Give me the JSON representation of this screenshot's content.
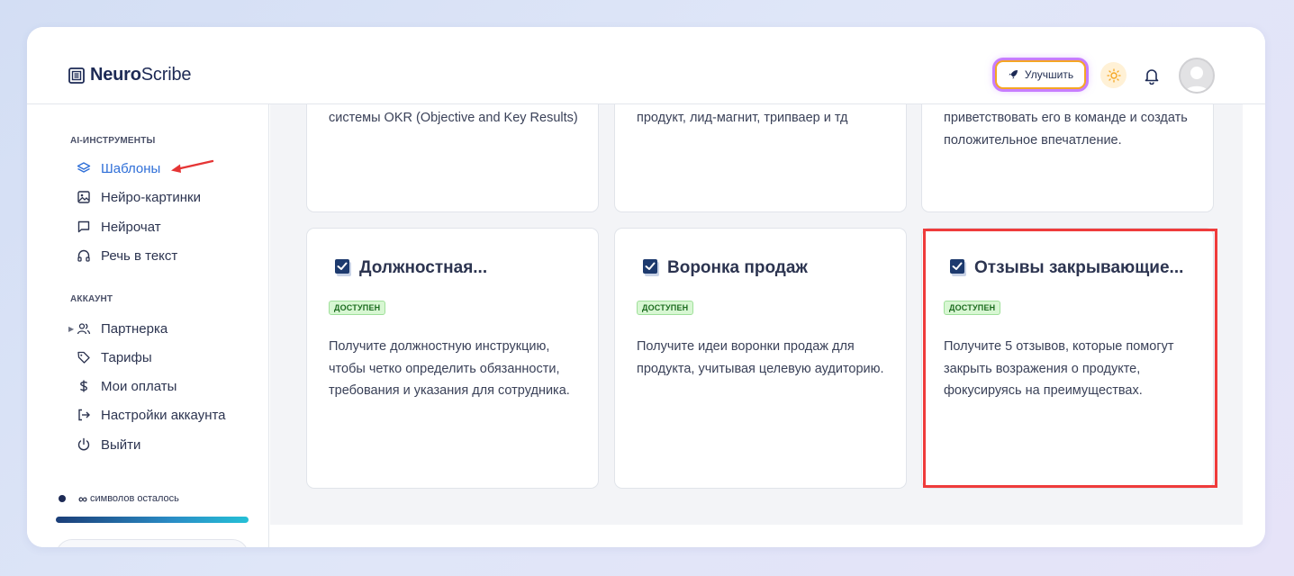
{
  "app": {
    "logo_bold": "Neuro",
    "logo_light": "Scribe"
  },
  "header": {
    "upgrade_label": "Улучшить"
  },
  "sidebar": {
    "ai_section_title": "AI-ИНСТРУМЕНТЫ",
    "ai_items": [
      {
        "label": "Шаблоны",
        "icon": "layers-icon",
        "active": true
      },
      {
        "label": "Нейро-картинки",
        "icon": "image-icon"
      },
      {
        "label": "Нейрочат",
        "icon": "chat-icon"
      },
      {
        "label": "Речь в текст",
        "icon": "headphones-icon"
      }
    ],
    "account_section_title": "АККАУНТ",
    "account_items": [
      {
        "label": "Партнерка",
        "icon": "users-icon"
      },
      {
        "label": "Тарифы",
        "icon": "tag-icon"
      },
      {
        "label": "Мои оплаты",
        "icon": "dollar-icon"
      },
      {
        "label": "Настройки аккаунта",
        "icon": "login-icon"
      },
      {
        "label": "Выйти",
        "icon": "power-icon"
      }
    ],
    "credits_symbol": "∞",
    "credits_label": "символов осталось"
  },
  "cards_top": [
    {
      "desc": "системы OKR (Objective and Key Results)"
    },
    {
      "desc": "продукт, лид-магнит, трипваер и тд"
    },
    {
      "desc": "приветствовать его в команде и создать положительное впечатление."
    }
  ],
  "cards": [
    {
      "title": "Должностная...",
      "badge": "ДОСТУПЕН",
      "desc": "Получите должностную инструкцию, чтобы четко определить обязанности, требования и указания для сотрудника."
    },
    {
      "title": "Воронка продаж",
      "badge": "ДОСТУПЕН",
      "desc": "Получите идеи воронки продаж для продукта, учитывая целевую аудиторию."
    },
    {
      "title": "Отзывы закрывающие...",
      "badge": "ДОСТУПЕН",
      "desc": "Получите 5 отзывов, которые помогут закрыть возражения о продукте, фокусируясь на преимуществах."
    }
  ],
  "colors": {
    "accent": "#2f6fd8",
    "highlight": "#ef3b3b",
    "badge_bg": "#d8f7d3"
  }
}
